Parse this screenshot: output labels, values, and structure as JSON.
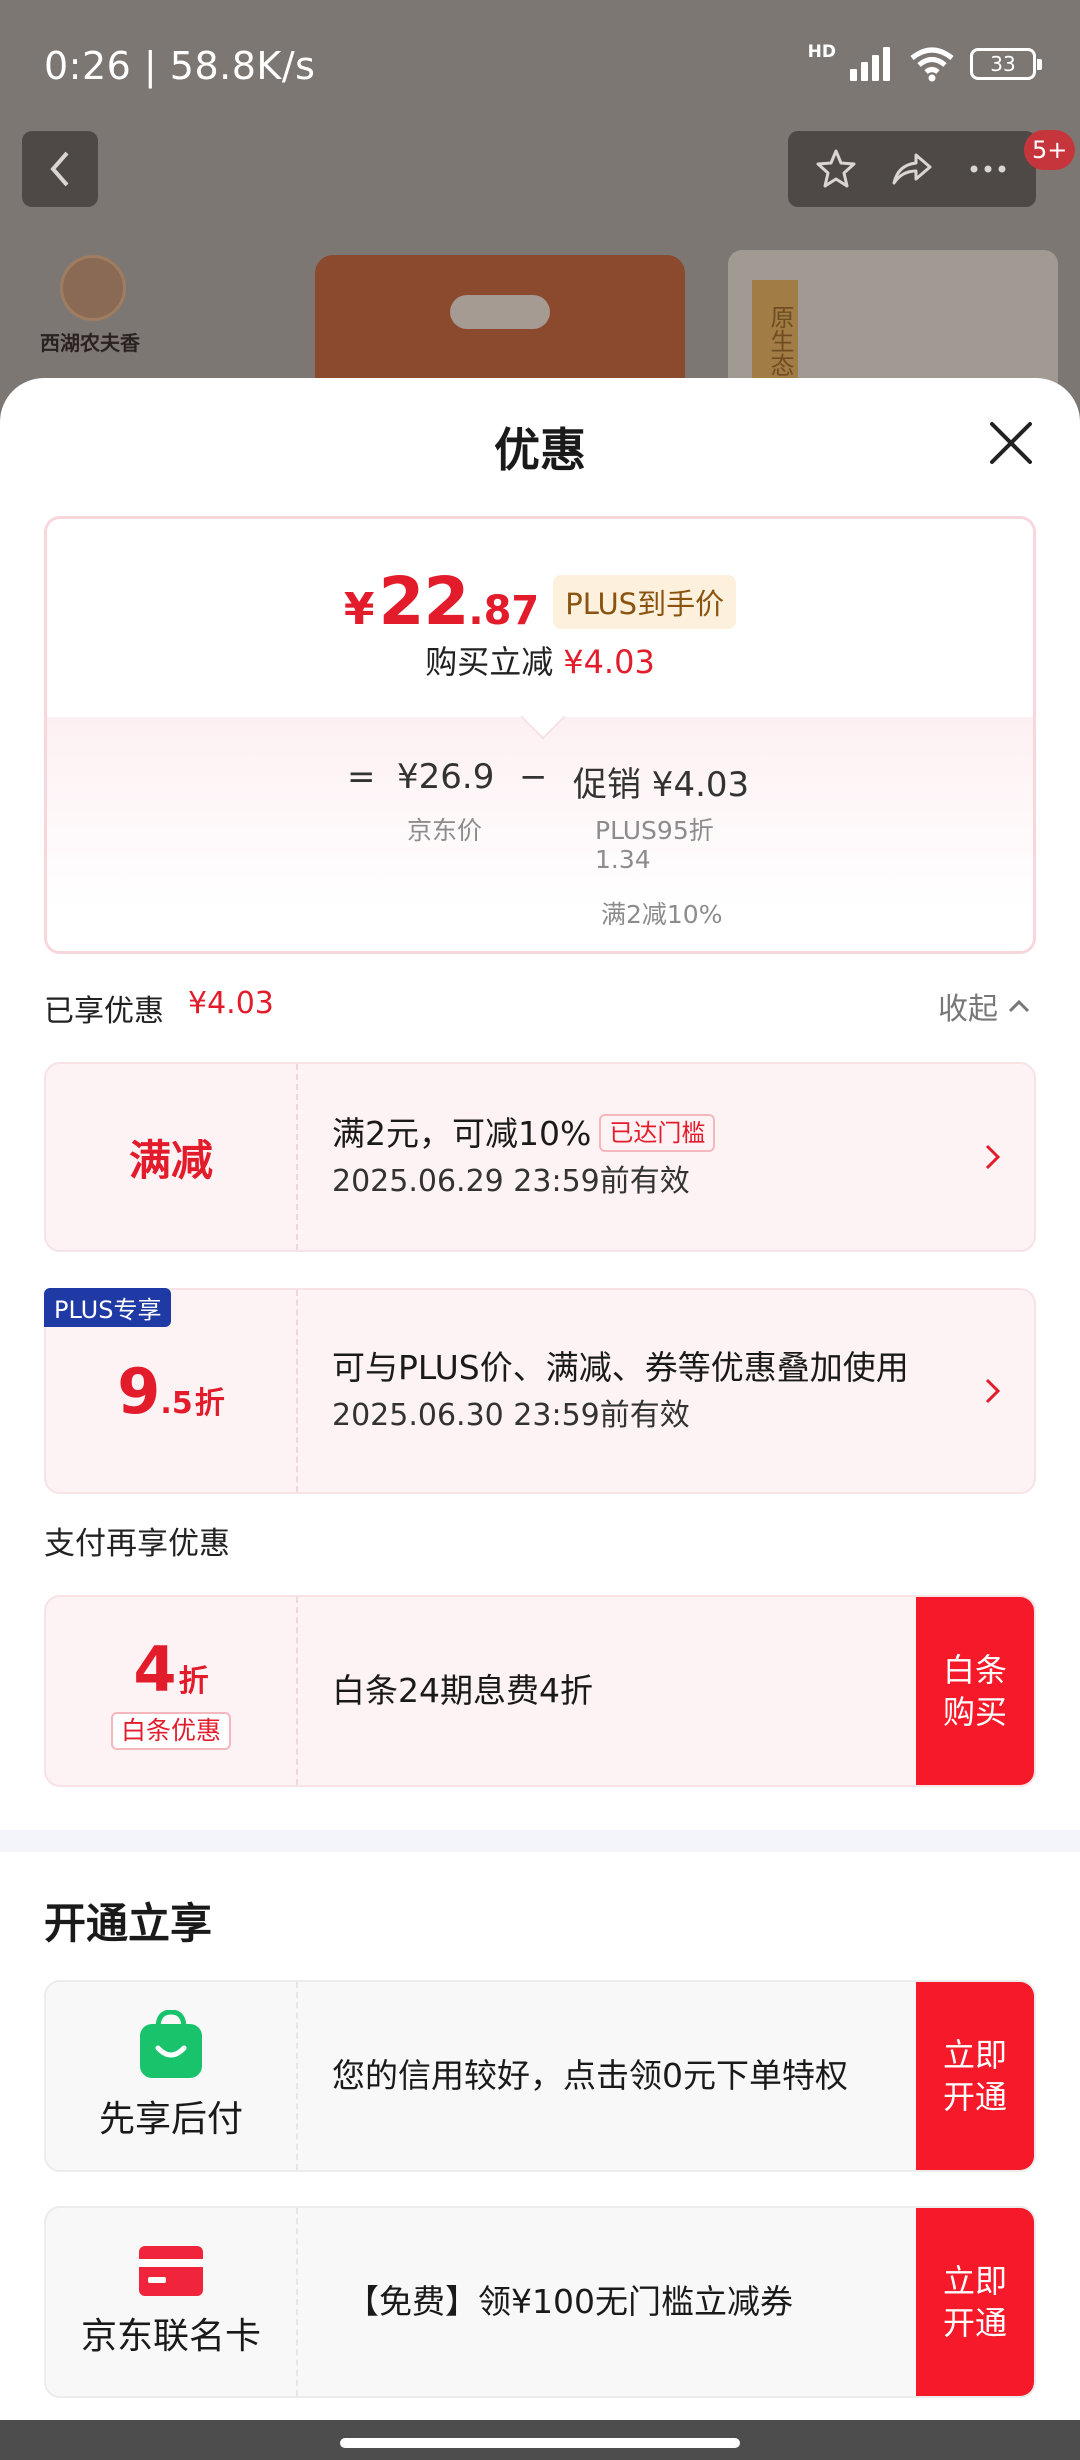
{
  "status_bar": {
    "time_speed": "0:26 | 58.8K/s",
    "network_label": "HD",
    "battery": "33"
  },
  "background": {
    "badge": "5+",
    "brand_name": "西湖农夫香",
    "product_tag": "原生态种"
  },
  "sheet": {
    "title": "优惠",
    "price_panel": {
      "currency": "¥",
      "price_int": "22",
      "price_dec": ".87",
      "plus_price_label": "PLUS到手价",
      "instant_reduce_label": "购买立减",
      "instant_reduce_amount": "¥4.03",
      "formula": {
        "equals": "=",
        "jd_price": "¥26.9",
        "jd_price_label": "京东价",
        "minus": "−",
        "promo_label": "促销 ¥4.03",
        "promo_detail_1": "PLUS95折",
        "promo_detail_2": "1.34",
        "promo_detail_3": "满2减10%"
      }
    },
    "enjoyed": {
      "label": "已享优惠",
      "amount": "¥4.03",
      "collapse": "收起"
    },
    "coupons": [
      {
        "left_label": "满减",
        "text": "满2元，可减10%",
        "tag": "已达门槛",
        "date": "2025.06.29 23:59前有效"
      },
      {
        "corner_tag": "PLUS专享",
        "disc_int": "9",
        "disc_dec": ".5",
        "disc_unit": "折",
        "text": "可与PLUS价、满减、券等优惠叠加使用",
        "date": "2025.06.30 23:59前有效"
      }
    ],
    "payment_section": {
      "label": "支付再享优惠",
      "card": {
        "disc_int": "4",
        "disc_unit": "折",
        "tag": "白条优惠",
        "text": "白条24期息费4折",
        "cta": "白条购买"
      }
    },
    "open_section": {
      "title": "开通立享",
      "items": [
        {
          "name": "先享后付",
          "icon": "shopping-bag-icon",
          "text": "您的信用较好，点击领0元下单特权",
          "cta": "立即开通"
        },
        {
          "name": "京东联名卡",
          "icon": "credit-card-icon",
          "text": "【免费】领¥100无门槛立减券",
          "cta": "立即开通"
        }
      ]
    }
  },
  "colors": {
    "accent_red": "#e31c2c",
    "cta_red": "#f5192a",
    "plus_blue": "#1f3aa5",
    "service_green": "#19c36b"
  }
}
